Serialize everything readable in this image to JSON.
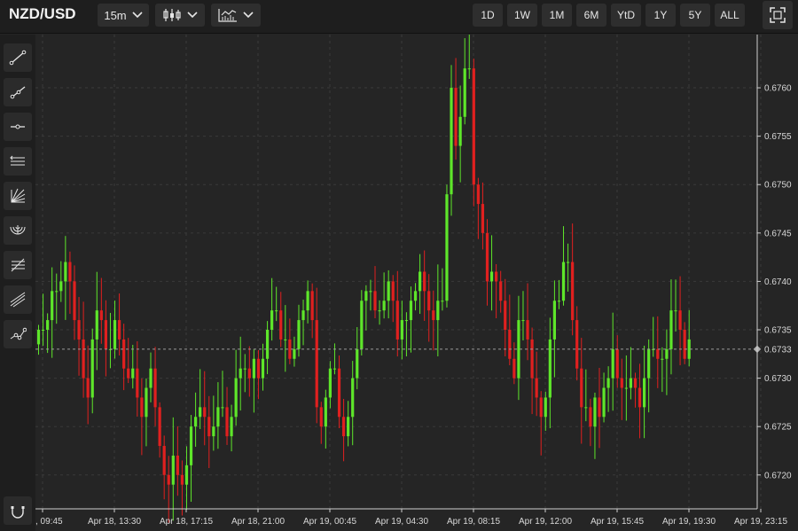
{
  "header": {
    "symbol": "NZD/USD",
    "interval": "15m",
    "chart_style_icon": "candlestick-icon",
    "indicator_icon": "indicators-icon",
    "ranges": [
      "1D",
      "1W",
      "1M",
      "6M",
      "YtD",
      "1Y",
      "5Y",
      "ALL"
    ],
    "fullscreen_icon": "fullscreen-icon"
  },
  "tools": [
    "trend-line-icon",
    "ray-icon",
    "horizontal-line-icon",
    "parallel-channel-icon",
    "fib-fan-icon",
    "fib-arc-icon",
    "fib-retracement-icon",
    "pitchfork-icon",
    "path-icon"
  ],
  "bottom_tool": "magnet-icon",
  "colors": {
    "up": "#5ee62a",
    "down": "#e0201f",
    "background": "#252525",
    "grid": "#3a3a3a",
    "axis": "#cfcfcf"
  },
  "chart_data": {
    "type": "candlestick",
    "interval": "15m",
    "x_ticks": [
      ", 09:45",
      "Apr 18, 13:30",
      "Apr 18, 17:15",
      "Apr 18, 21:00",
      "Apr 19, 00:45",
      "Apr 19, 04:30",
      "Apr 19, 08:15",
      "Apr 19, 12:00",
      "Apr 19, 15:45",
      "Apr 19, 19:30",
      "Apr 19, 23:15"
    ],
    "y_ticks": [
      0.672,
      0.6725,
      0.673,
      0.6735,
      0.674,
      0.6745,
      0.675,
      0.6755,
      0.676
    ],
    "ylim": [
      0.67165,
      0.67655
    ],
    "grid": true,
    "last_price": 0.6733,
    "last_price_label": "0.6733",
    "close": [
      0.6735,
      0.6735,
      0.6736,
      0.6739,
      0.6739,
      0.674,
      0.6742,
      0.674,
      0.6736,
      0.6734,
      0.673,
      0.6728,
      0.6734,
      0.6737,
      0.6736,
      0.6733,
      0.6733,
      0.6736,
      0.6734,
      0.6731,
      0.673,
      0.6731,
      0.6728,
      0.6726,
      0.6729,
      0.6731,
      0.6727,
      0.6723,
      0.672,
      0.6719,
      0.6722,
      0.672,
      0.6719,
      0.6721,
      0.6725,
      0.6726,
      0.6727,
      0.6726,
      0.6724,
      0.6725,
      0.6727,
      0.6727,
      0.6724,
      0.6726,
      0.673,
      0.6731,
      0.6731,
      0.673,
      0.6732,
      0.673,
      0.6732,
      0.6735,
      0.6737,
      0.6737,
      0.6734,
      0.6734,
      0.6732,
      0.6733,
      0.6736,
      0.6737,
      0.6739,
      0.6736,
      0.6727,
      0.6725,
      0.6728,
      0.6731,
      0.6731,
      0.6726,
      0.6724,
      0.6726,
      0.673,
      0.6733,
      0.6738,
      0.6739,
      0.6739,
      0.6737,
      0.6737,
      0.6738,
      0.674,
      0.6738,
      0.6734,
      0.6736,
      0.6736,
      0.6738,
      0.6739,
      0.6741,
      0.6739,
      0.6737,
      0.6736,
      0.6738,
      0.6738,
      0.6749,
      0.676,
      0.6754,
      0.6757,
      0.6762,
      0.6762,
      0.675,
      0.6748,
      0.6745,
      0.674,
      0.6741,
      0.674,
      0.6738,
      0.6735,
      0.6732,
      0.673,
      0.6736,
      0.6736,
      0.6734,
      0.673,
      0.6728,
      0.6726,
      0.6728,
      0.6734,
      0.6738,
      0.6738,
      0.6742,
      0.6742,
      0.6736,
      0.6731,
      0.6727,
      0.6727,
      0.6725,
      0.6728,
      0.6726,
      0.6729,
      0.673,
      0.6733,
      0.673,
      0.6729,
      0.6729,
      0.673,
      0.6729,
      0.6727,
      0.673,
      0.6733,
      0.6733,
      0.6732,
      0.6732,
      0.6733,
      0.6737,
      0.6737,
      0.6735,
      0.6732,
      0.6734
    ]
  }
}
